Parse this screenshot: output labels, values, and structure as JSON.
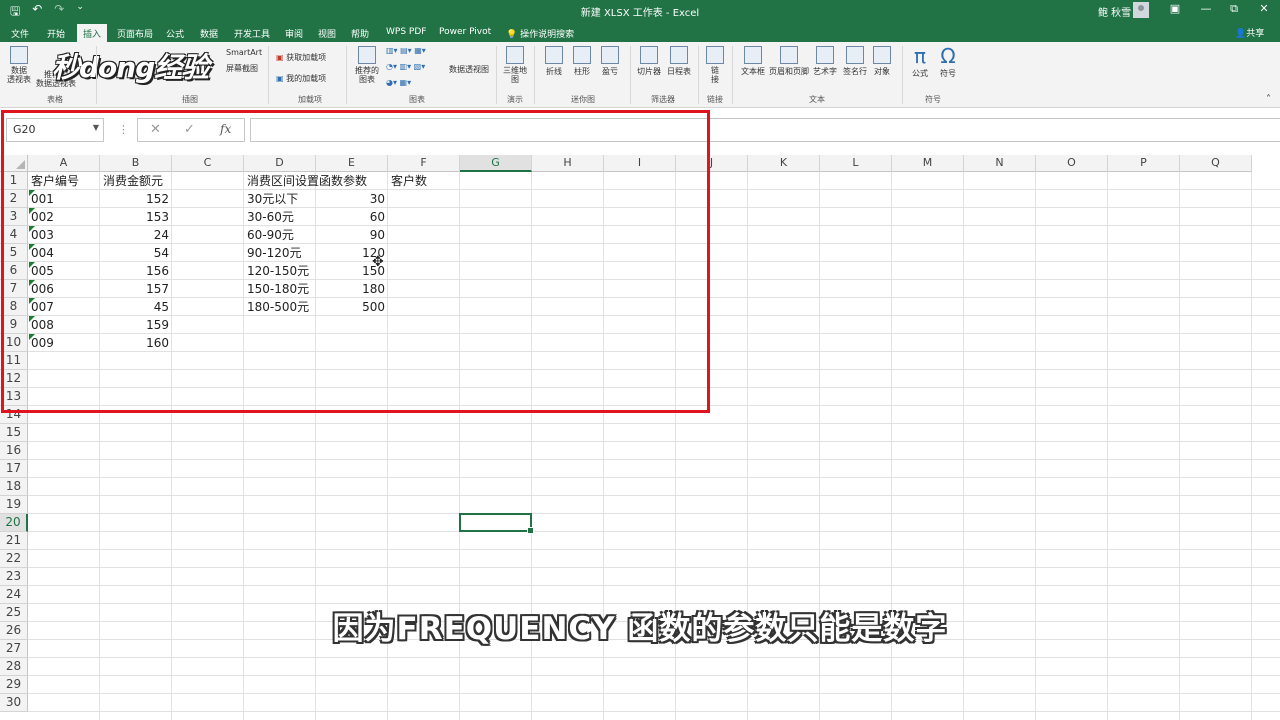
{
  "window": {
    "title": "新建 XLSX 工作表 - Excel",
    "user": "鲍 秋雪",
    "buttons": [
      "—",
      "▭",
      "⧉",
      "✕"
    ]
  },
  "qat": {
    "save_icon": "save-icon",
    "undo_icon": "undo-icon",
    "redo_icon": "redo-icon"
  },
  "tabs": [
    {
      "label": "文件"
    },
    {
      "label": "开始"
    },
    {
      "label": "插入",
      "active": true
    },
    {
      "label": "页面布局"
    },
    {
      "label": "公式"
    },
    {
      "label": "数据"
    },
    {
      "label": "开发工具"
    },
    {
      "label": "审阅"
    },
    {
      "label": "视图"
    },
    {
      "label": "帮助"
    },
    {
      "label": "WPS PDF"
    },
    {
      "label": "Power Pivot"
    },
    {
      "label": "操作说明搜索"
    }
  ],
  "share_label": "共享",
  "ribbon": {
    "watermark": "秒dong经验",
    "items": {
      "pivot": "数据\n透视表",
      "rec_pivot": "推荐的\n数据透视表",
      "smartart": "SmartArt",
      "screenshot": "屏幕截图",
      "get_addins": "获取加载项",
      "my_addins": "我的加载项",
      "rec_charts": "推荐的\n图表",
      "pivot_chart": "数据透视图",
      "map3d": "三维地\n图",
      "line": "折线",
      "column": "柱形",
      "winloss": "盈亏",
      "slicer": "切片器",
      "timeline": "日程表",
      "link": "链\n接",
      "textbox": "文本框",
      "header_footer": "页眉和页脚",
      "wordart": "艺术字",
      "signature": "签名行",
      "object": "对象",
      "equation": "公式",
      "symbol": "符号"
    },
    "groups": {
      "tables": "表格",
      "illustrations": "插图",
      "addins": "加载项",
      "charts": "图表",
      "tours": "演示",
      "sparklines": "迷你图",
      "filters": "筛选器",
      "links": "链接",
      "text": "文本",
      "symbols": "符号"
    }
  },
  "formula_bar": {
    "name_box": "G20",
    "cancel": "✕",
    "enter": "✓",
    "fx": "fx",
    "value": ""
  },
  "grid": {
    "columns": [
      "A",
      "B",
      "C",
      "D",
      "E",
      "F",
      "G",
      "H",
      "I",
      "J",
      "K",
      "L",
      "M",
      "N",
      "O",
      "P",
      "Q"
    ],
    "selected_column": "G",
    "rows": [
      "1",
      "2",
      "3",
      "4",
      "5",
      "6",
      "7",
      "8",
      "9",
      "10",
      "11",
      "12",
      "13",
      "14",
      "15",
      "16",
      "17",
      "18",
      "19",
      "20",
      "21",
      "22",
      "23",
      "24",
      "25",
      "26",
      "27",
      "28",
      "29",
      "30"
    ],
    "selected_row": "20",
    "headers": {
      "A": "客户编号",
      "B": "消费金额元",
      "D": "消费区间设置",
      "E": "函数参数",
      "F": "客户数"
    },
    "col_a": [
      "001",
      "002",
      "003",
      "004",
      "005",
      "006",
      "007",
      "008",
      "009"
    ],
    "col_b": [
      "152",
      "153",
      "24",
      "54",
      "156",
      "157",
      "45",
      "159",
      "160"
    ],
    "col_d": [
      "30元以下",
      "30-60元",
      "60-90元",
      "90-120元",
      "120-150元",
      "150-180元",
      "180-500元"
    ],
    "col_e": [
      "30",
      "60",
      "90",
      "120",
      "150",
      "180",
      "500"
    ]
  },
  "subtitle": "因为FREQUENCY 函数的参数只能是数字"
}
